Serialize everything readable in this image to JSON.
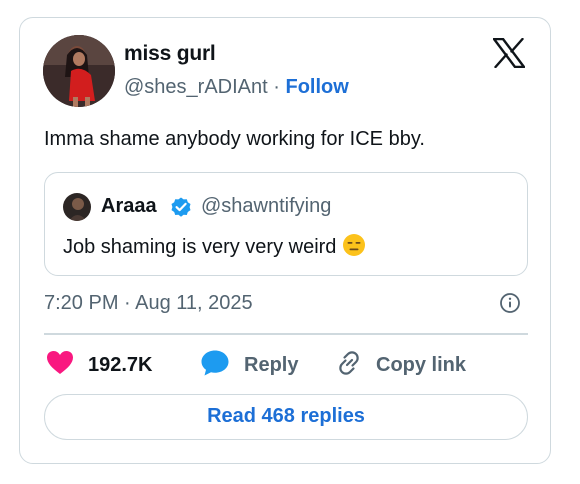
{
  "author": {
    "display_name": "miss gurl",
    "handle": "@shes_rADIAnt",
    "separator": "·",
    "follow_label": "Follow"
  },
  "tweet": {
    "text": "Imma shame anybody working for ICE bby.",
    "timestamp": "7:20 PM · Aug 11, 2025"
  },
  "quoted": {
    "display_name": "Araaa",
    "handle": "@shawntifying",
    "text": "Job shaming is very very weird",
    "emoji_name": "expressionless-face-emoji"
  },
  "actions": {
    "like_count": "192.7K",
    "reply_label": "Reply",
    "copy_label": "Copy link",
    "read_replies_label": "Read 468 replies"
  },
  "colors": {
    "accent_blue": "#1d6fd6",
    "like_pink": "#f91880",
    "reply_blue": "#1d9bf0",
    "muted_text": "#536471",
    "border": "#cfd9de"
  }
}
